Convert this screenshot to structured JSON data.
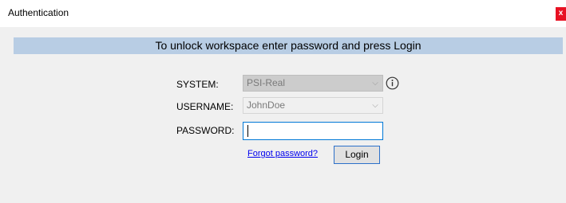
{
  "window": {
    "title": "Authentication",
    "close_label": "x"
  },
  "banner": {
    "text": "To unlock workspace enter password and press Login"
  },
  "form": {
    "system_label": "SYSTEM:",
    "system_value": "PSI-Real",
    "username_label": "USERNAME:",
    "username_value": "JohnDoe",
    "password_label": "PASSWORD:",
    "password_value": "",
    "forgot_link": "Forgot password?",
    "login_button": "Login"
  },
  "colors": {
    "banner_bg": "#b8cde4",
    "client_bg": "#f0f0f0",
    "focus_border": "#0078d7",
    "link": "#0000ee",
    "close_bg": "#e81123"
  },
  "icons": [
    "chevron-down-icon",
    "info-icon",
    "close-icon"
  ]
}
